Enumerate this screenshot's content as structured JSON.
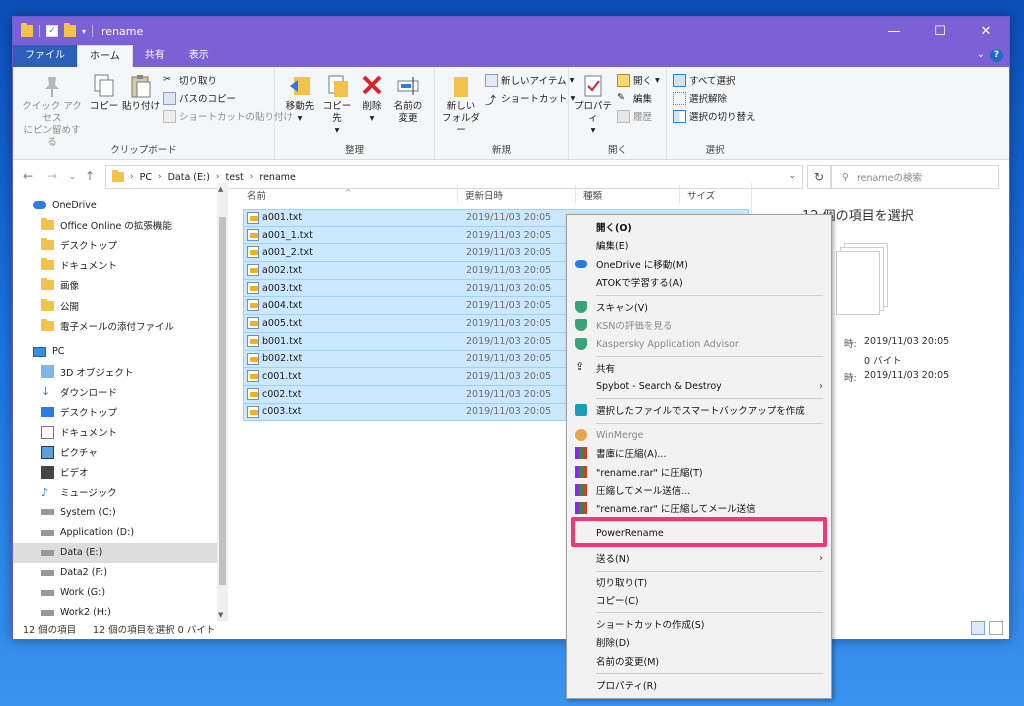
{
  "window": {
    "title": "rename"
  },
  "ribbon_tabs": [
    "ファイル",
    "ホーム",
    "共有",
    "表示"
  ],
  "help_label": "?",
  "ribbon": {
    "clipboard": {
      "label": "クリップボード",
      "pin_line1": "クイック アクセス",
      "pin_line2": "にピン留めする",
      "copy": "コピー",
      "paste": "貼り付け",
      "cut": "切り取り",
      "copy_path": "パスのコピー",
      "paste_shortcut": "ショートカットの貼り付け"
    },
    "organize": {
      "label": "整理",
      "move_to": "移動先",
      "copy_to": "コピー先",
      "delete": "削除",
      "rename_line1": "名前の",
      "rename_line2": "変更"
    },
    "new": {
      "label": "新規",
      "new_folder_line1": "新しい",
      "new_folder_line2": "フォルダー",
      "new_item": "新しいアイテム",
      "shortcut": "ショートカット"
    },
    "open": {
      "label": "開く",
      "properties": "プロパティ",
      "open": "開く",
      "edit": "編集",
      "history": "履歴"
    },
    "select": {
      "label": "選択",
      "select_all": "すべて選択",
      "select_none": "選択解除",
      "invert": "選択の切り替え"
    }
  },
  "address": {
    "crumbs": [
      "PC",
      "Data (E:)",
      "test",
      "rename"
    ],
    "search_placeholder": "renameの検索"
  },
  "nav": {
    "onedrive": "OneDrive",
    "onedrive_items": [
      "Office Online の拡張機能",
      "デスクトップ",
      "ドキュメント",
      "画像",
      "公開",
      "電子メールの添付ファイル"
    ],
    "pc": "PC",
    "pc_items": [
      "3D オブジェクト",
      "ダウンロード",
      "デスクトップ",
      "ドキュメント",
      "ピクチャ",
      "ビデオ",
      "ミュージック",
      "System (C:)",
      "Application (D:)",
      "Data (E:)",
      "Data2 (F:)",
      "Work (G:)",
      "Work2 (H:)"
    ]
  },
  "columns": {
    "name": "名前",
    "date": "更新日時",
    "type": "種類",
    "size": "サイズ"
  },
  "files": [
    {
      "name": "a001.txt",
      "date": "2019/11/03 20:05"
    },
    {
      "name": "a001_1.txt",
      "date": "2019/11/03 20:05"
    },
    {
      "name": "a001_2.txt",
      "date": "2019/11/03 20:05"
    },
    {
      "name": "a002.txt",
      "date": "2019/11/03 20:05"
    },
    {
      "name": "a003.txt",
      "date": "2019/11/03 20:05"
    },
    {
      "name": "a004.txt",
      "date": "2019/11/03 20:05"
    },
    {
      "name": "a005.txt",
      "date": "2019/11/03 20:05"
    },
    {
      "name": "b001.txt",
      "date": "2019/11/03 20:05"
    },
    {
      "name": "b002.txt",
      "date": "2019/11/03 20:05"
    },
    {
      "name": "c001.txt",
      "date": "2019/11/03 20:05"
    },
    {
      "name": "c002.txt",
      "date": "2019/11/03 20:05"
    },
    {
      "name": "c003.txt",
      "date": "2019/11/03 20:05"
    }
  ],
  "details": {
    "title": "12 個の項目を選択",
    "label1": "時:",
    "val1": "2019/11/03 20:05",
    "val2": "0 バイト",
    "label3": "時:",
    "val3": "2019/11/03 20:05"
  },
  "context_menu": {
    "open": "開く(O)",
    "edit": "編集(E)",
    "onedrive_move": "OneDrive に移動(M)",
    "atok": "ATOKで学習する(A)",
    "scan": "スキャン(V)",
    "ksn": "KSNの評価を見る",
    "kaspersky": "Kaspersky Application Advisor",
    "share": "共有",
    "spybot": "Spybot - Search & Destroy",
    "smart_backup": "選択したファイルでスマートバックアップを作成",
    "winmerge": "WinMerge",
    "compress_archive": "書庫に圧縮(A)...",
    "compress_rar": "\"rename.rar\" に圧縮(T)",
    "compress_mail": "圧縮してメール送信...",
    "compress_rar_mail": "\"rename.rar\" に圧縮してメール送信",
    "powerrename": "PowerRename",
    "send_to": "送る(N)",
    "cut": "切り取り(T)",
    "copy": "コピー(C)",
    "create_shortcut": "ショートカットの作成(S)",
    "delete": "削除(D)",
    "rename": "名前の変更(M)",
    "properties": "プロパティ(R)"
  },
  "status": {
    "count": "12 個の項目",
    "selected": "12 個の項目を選択 0 バイト"
  },
  "colors": {
    "titlebar": "#7a62d6",
    "selection": "#cce8ff",
    "highlight_box": "#ee3a78"
  }
}
